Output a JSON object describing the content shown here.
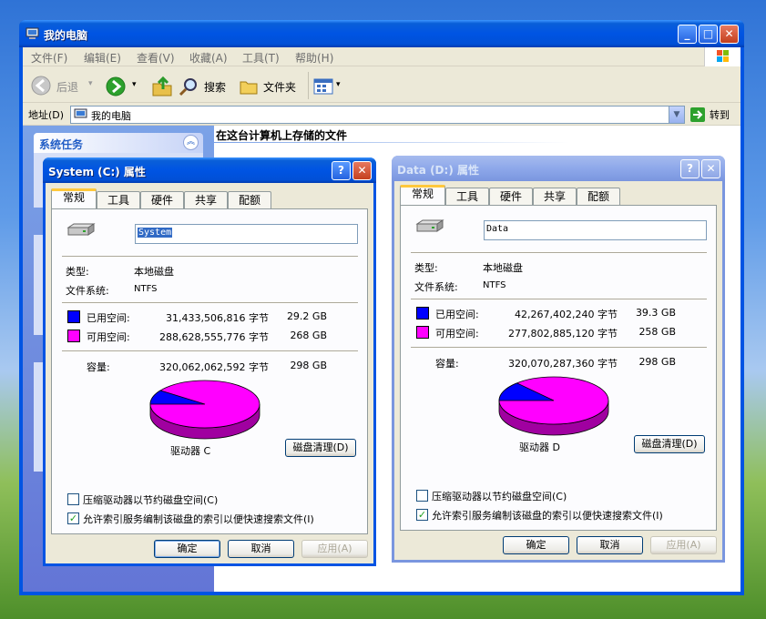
{
  "explorer": {
    "title": "我的电脑",
    "menu": [
      "文件(F)",
      "编辑(E)",
      "查看(V)",
      "收藏(A)",
      "工具(T)",
      "帮助(H)"
    ],
    "toolbar": {
      "back": "后退",
      "search": "搜索",
      "folders": "文件夹"
    },
    "address": {
      "label": "地址(D)",
      "value": "我的电脑",
      "go": "转到"
    },
    "left_panel_heading": "系统任务",
    "right_heading": "在这台计算机上存储的文件"
  },
  "dialog_c": {
    "title": "System (C:) 属性",
    "tabs": [
      "常规",
      "工具",
      "硬件",
      "共享",
      "配额"
    ],
    "name_value": "System",
    "type_label": "类型:",
    "type_value": "本地磁盘",
    "fs_label": "文件系统:",
    "fs_value": "NTFS",
    "used_label": "已用空间:",
    "used_bytes": "31,433,506,816 字节",
    "used_gb": "29.2 GB",
    "free_label": "可用空间:",
    "free_bytes": "288,628,555,776 字节",
    "free_gb": "268 GB",
    "capacity_label": "容量:",
    "capacity_bytes": "320,062,062,592 字节",
    "capacity_gb": "298 GB",
    "drive_label": "驱动器 C",
    "cleanup": "磁盘清理(D)",
    "compress": "压缩驱动器以节约磁盘空间(C)",
    "index": "允许索引服务编制该磁盘的索引以便快速搜索文件(I)",
    "compress_checked": false,
    "index_checked": true,
    "ok": "确定",
    "cancel": "取消",
    "apply": "应用(A)",
    "used_fraction": 0.0982
  },
  "dialog_d": {
    "title": "Data (D:) 属性",
    "tabs": [
      "常规",
      "工具",
      "硬件",
      "共享",
      "配额"
    ],
    "name_value": "Data",
    "type_label": "类型:",
    "type_value": "本地磁盘",
    "fs_label": "文件系统:",
    "fs_value": "NTFS",
    "used_label": "已用空间:",
    "used_bytes": "42,267,402,240 字节",
    "used_gb": "39.3 GB",
    "free_label": "可用空间:",
    "free_bytes": "277,802,885,120 字节",
    "free_gb": "258 GB",
    "capacity_label": "容量:",
    "capacity_bytes": "320,070,287,360 字节",
    "capacity_gb": "298 GB",
    "drive_label": "驱动器 D",
    "cleanup": "磁盘清理(D)",
    "compress": "压缩驱动器以节约磁盘空间(C)",
    "index": "允许索引服务编制该磁盘的索引以便快速搜索文件(I)",
    "compress_checked": false,
    "index_checked": true,
    "ok": "确定",
    "cancel": "取消",
    "apply": "应用(A)",
    "used_fraction": 0.132
  },
  "colors": {
    "used": "#0000ff",
    "free": "#ff00ff"
  }
}
